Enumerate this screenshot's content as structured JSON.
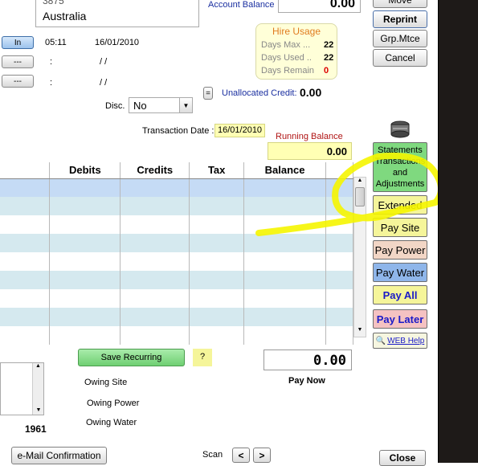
{
  "address": {
    "postcode": "3875",
    "country": "Australia"
  },
  "account": {
    "balance_label": "Account Balance",
    "balance_value": "0.00"
  },
  "actions": {
    "move": "Move",
    "reprint": "Reprint",
    "grp_mtce": "Grp.Mtce",
    "cancel": "Cancel"
  },
  "hire_usage": {
    "title": "Hire Usage",
    "rows": [
      {
        "label": "Days Max ...",
        "value": "22"
      },
      {
        "label": "Days Used ..",
        "value": "22"
      },
      {
        "label": "Days Remain",
        "value": "0"
      }
    ]
  },
  "times": [
    {
      "button": "In",
      "time": "05:11",
      "date": "16/01/2010"
    },
    {
      "button": "---",
      "time": ":",
      "date": "/ /"
    },
    {
      "button": "---",
      "time": ":",
      "date": "/ /"
    }
  ],
  "disc": {
    "label": "Disc.",
    "value": "No"
  },
  "unallocated": {
    "label": "Unallocated Credit:",
    "value": "0.00",
    "button": "="
  },
  "transaction": {
    "label": "Transaction Date :",
    "value": "16/01/2010"
  },
  "running_balance": {
    "label": "Running Balance",
    "value": "0.00"
  },
  "table": {
    "columns": [
      "Debits",
      "Credits",
      "Tax",
      "Balance"
    ],
    "row_count": 9
  },
  "side_buttons": {
    "statements": "Statements Transactions and Adjustments",
    "extended": "Extended",
    "pay_site": "Pay Site",
    "pay_power": "Pay Power",
    "pay_water": "Pay Water",
    "pay_all": "Pay All",
    "pay_later": "Pay Later",
    "web_help": "WEB Help"
  },
  "save_recurring": "Save Recurring",
  "question": "?",
  "pay_now": {
    "amount": "0.00",
    "label": "Pay Now"
  },
  "owing": [
    "Owing Site",
    "Owing Power",
    "Owing Water"
  ],
  "year": "1961",
  "email_confirmation": "e-Mail Confirmation",
  "scan": {
    "label": "Scan",
    "prev": "<",
    "next": ">"
  },
  "close": "Close",
  "colors": {
    "highlight_row": "#c5dbf5",
    "alt_row": "#d5e9ef",
    "annotation": "#f5f500",
    "statements_bg": "#7fd97f",
    "pay_water_bg": "#8fb6ea",
    "pay_power_bg": "#f2d6c6",
    "pay_later_bg": "#f5c2c2",
    "pay_all_bg": "#f5f59a"
  }
}
